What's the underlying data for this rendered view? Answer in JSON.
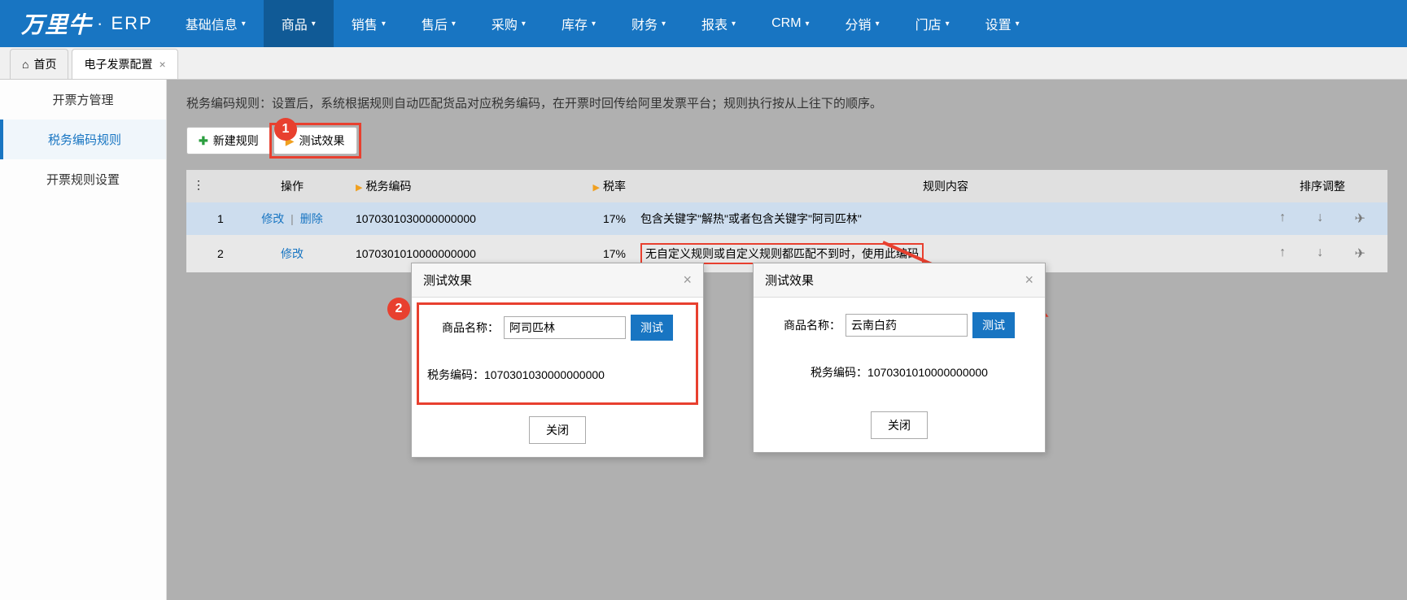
{
  "logo": {
    "brand": "万里牛",
    "product": "· ERP"
  },
  "nav": [
    {
      "label": "基础信息",
      "active": false
    },
    {
      "label": "商品",
      "active": true
    },
    {
      "label": "销售",
      "active": false
    },
    {
      "label": "售后",
      "active": false
    },
    {
      "label": "采购",
      "active": false
    },
    {
      "label": "库存",
      "active": false
    },
    {
      "label": "财务",
      "active": false
    },
    {
      "label": "报表",
      "active": false
    },
    {
      "label": "CRM",
      "active": false
    },
    {
      "label": "分销",
      "active": false
    },
    {
      "label": "门店",
      "active": false
    },
    {
      "label": "设置",
      "active": false
    }
  ],
  "tabs": {
    "home": "首页",
    "active": "电子发票配置"
  },
  "sidebar": [
    {
      "label": "开票方管理",
      "active": false
    },
    {
      "label": "税务编码规则",
      "active": true
    },
    {
      "label": "开票规则设置",
      "active": false
    }
  ],
  "description": "税务编码规则：设置后，系统根据规则自动匹配货品对应税务编码，在开票时回传给阿里发票平台；规则执行按从上往下的顺序。",
  "buttons": {
    "new_rule": "新建规则",
    "test_effect": "测试效果"
  },
  "table": {
    "headers": {
      "op": "操作",
      "code": "税务编码",
      "rate": "税率",
      "rule": "规则内容",
      "sort": "排序调整"
    },
    "rows": [
      {
        "idx": "1",
        "ops": [
          "修改",
          "删除"
        ],
        "code": "1070301030000000000",
        "rate": "17%",
        "rule": "包含关键字\"解热\"或者包含关键字\"阿司匹林\""
      },
      {
        "idx": "2",
        "ops": [
          "修改"
        ],
        "code": "1070301010000000000",
        "rate": "17%",
        "rule": "无自定义规则或自定义规则都匹配不到时，使用此编码"
      }
    ]
  },
  "dialog1": {
    "title": "测试效果",
    "label": "商品名称：",
    "input_value": "阿司匹林",
    "test_btn": "测试",
    "result_label": "税务编码：",
    "result_value": "1070301030000000000",
    "close": "关闭"
  },
  "dialog2": {
    "title": "测试效果",
    "label": "商品名称：",
    "input_value": "云南白药",
    "test_btn": "测试",
    "result_label": "税务编码：",
    "result_value": "1070301010000000000",
    "close": "关闭"
  },
  "annotations": {
    "badge1": "1",
    "badge2": "2"
  }
}
